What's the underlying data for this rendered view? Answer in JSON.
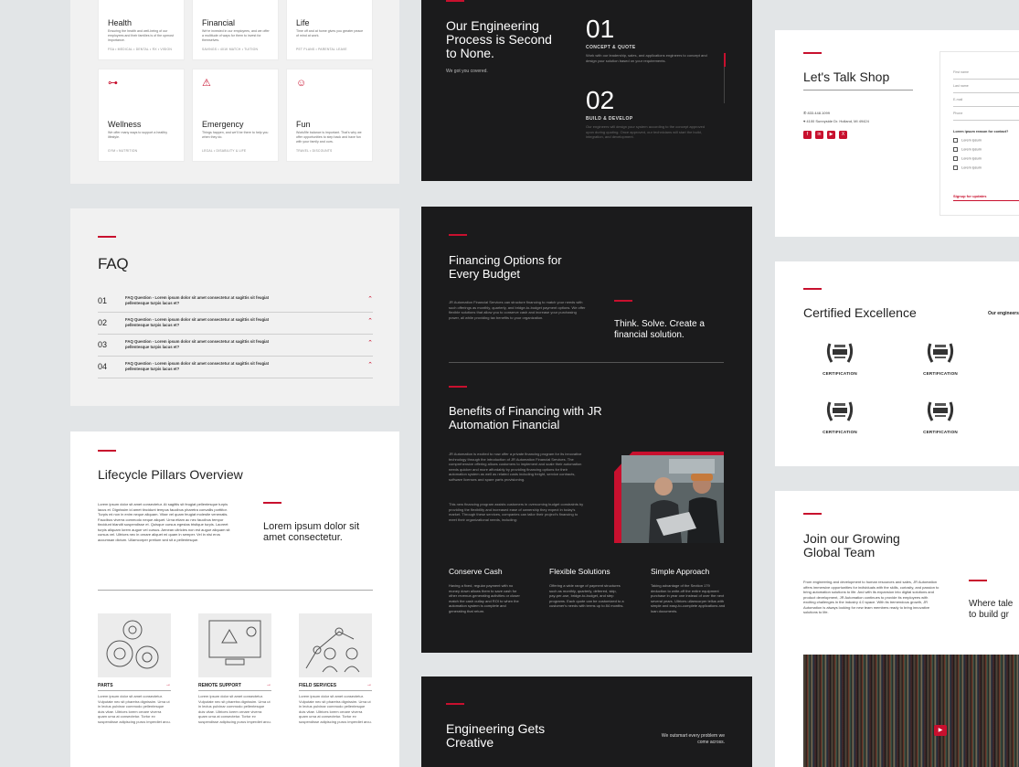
{
  "benefits": [
    {
      "title": "Health",
      "desc": "Ensuring the health and well-being of our employees and their families is of the upmost importance.",
      "footer": "FSA • MEDICAL • DENTAL • RX • VISION",
      "icon": "health-icon",
      "glyph": ""
    },
    {
      "title": "Financial",
      "desc": "We're invested in our employees, and we offer a multitude of ways for them to invest for themselves.",
      "footer": "SAVINGS • 401K MATCH • TUITION",
      "icon": "financial-icon",
      "glyph": ""
    },
    {
      "title": "Life",
      "desc": "Time off and at home gives you greater peace of mind at work.",
      "footer": "PET PLANS • PARENTAL LEAVE",
      "icon": "life-icon",
      "glyph": ""
    },
    {
      "title": "Wellness",
      "desc": "We offer many ways to support a healthy lifestyle.",
      "footer": "GYM • NUTRITION",
      "icon": "dumbbell-icon",
      "glyph": "⊶"
    },
    {
      "title": "Emergency",
      "desc": "Things happen, and we'll be there to help you when they do.",
      "footer": "LEGAL • DISABILITY & LIFE",
      "icon": "warning-icon",
      "glyph": "⚠"
    },
    {
      "title": "Fun",
      "desc": "Work/life balance is important. That's why we offer opportunities to step back and have fun with your family and ours.",
      "footer": "TRAVEL • DISCOUNTS",
      "icon": "smiley-icon",
      "glyph": "☺"
    }
  ],
  "engineering": {
    "title": "Our Engineering Process is Second to None.",
    "subtitle": "We got you covered.",
    "steps": [
      {
        "num": "01",
        "title": "CONCEPT & QUOTE",
        "desc": "Work with our leadership, sales, and applications engineers to concept and design your solution based on your requirements."
      },
      {
        "num": "02",
        "title": "BUILD & DEVELOP",
        "desc": "Our engineers will design your system according to the concept approved upon during quoting. Once approved, our technicians will start the build, integration, and development."
      }
    ]
  },
  "contact": {
    "title": "Let's Talk Shop",
    "phone": "833.448.1099",
    "address": "4100 Sunnyside Dr. Holland, MI 49424",
    "socials": [
      "f",
      "in",
      "▶",
      "X"
    ],
    "fields": [
      "First name",
      "Last name",
      "E-mail",
      "Phone"
    ],
    "reason_label": "Lorem ipsum reason for contact?",
    "options": [
      "Lorem ipsum",
      "Lorem ipsum",
      "Lorem ipsum",
      "Lorem ipsum"
    ],
    "signup": "Signup for updates"
  },
  "faq": {
    "title": "FAQ",
    "items": [
      {
        "num": "01",
        "q": "FAQ Question - Lorem ipsum dolor sit amet consectetur at sagittis sit feugiat pellentesque turpis lacus et?"
      },
      {
        "num": "02",
        "q": "FAQ Question - Lorem ipsum dolor sit amet consectetur at sagittis sit feugiat pellentesque turpis lacus et?"
      },
      {
        "num": "03",
        "q": "FAQ Question - Lorem ipsum dolor sit amet consectetur at sagittis sit feugiat pellentesque turpis lacus et?"
      },
      {
        "num": "04",
        "q": "FAQ Question - Lorem ipsum dolor sit amet consectetur at sagittis sit feugiat pellentesque turpis lacus et?"
      }
    ]
  },
  "financing": {
    "title": "Financing Options for Every Budget",
    "body": "JR Automation Financial Services can structure financing to match your needs with such offerings as monthly, quarterly, and bridge-to-budget payment options. We offer flexible solutions that allow you to conserve cash and increase your purchasing power, all while providing tax benefits to your organization.",
    "tagline": "Think. Solve. Create a financial solution.",
    "benefits_title": "Benefits of Financing with JR Automation Financial",
    "benefits_body_1": "JR Automation is excited to now offer a private financing program for its innovative technology through the introduction of JR Automation Financial Services. The comprehensive offering allows customers to implement and scale their automation needs quicker and more affordably by providing financing options for their automation system as well as related costs including freight, service contracts, software licenses and spare parts provisioning.",
    "benefits_body_2": "This new financing program assists customers in overcoming budget constraints by providing the flexibility and increased ease of ownership they expect in today's market. Through these services, companies can tailor their project's financing to meet their organizational needs, including:",
    "columns": [
      {
        "title": "Conserve Cash",
        "desc": "Having a fixed, regular payment with no money down allows them to save cash for other revenue-generating activities or closer match the cash outlay and ROI to when the automation system is complete and generating that return."
      },
      {
        "title": "Flexible Solutions",
        "desc": "Offering a wide range of payment structures such as monthly, quarterly, deferred, skip, pay-per-use, bridge-to-budget, and step programs. Each quote can be customized to a customer's needs with terms up to 84 months."
      },
      {
        "title": "Simple Approach",
        "desc": "Taking advantage of the Section 179 deduction to write-off the entire equipment purchase in year one instead of over the next several years. Ultrices ullamcorper tellus with simple and easy-to-complete applications and loan documents."
      }
    ]
  },
  "certified": {
    "title": "Certified Excellence",
    "side_text": "Our engineers",
    "badges": [
      "CERTIFICATION",
      "CERTIFICATION",
      "CERTIFICATION",
      "CERTIFICATION"
    ]
  },
  "lifecycle": {
    "title": "Lifecycle Pillars Overview",
    "body": "Lorem ipsum dolor sit amet consectetur. At sagittis sit feugiat pellentesque turpis lacus et. Dignissim id amet tincidunt tempus faucibus pharetra convallis porttitor. Turpis mi non in enim neque aliquam. Vitae vel quam feugiat molestie venenatis. Faucibus viverra commodo neque aliquet. Urna etiam ac nec faucibus tempor tincidunt blandit suspendisse et. Quisque cursus egestas tristique turpis. Laoreet turpis aliquam lorem augue vel cursus. Aenean ultricies non est augue aliquam sit cursus vel. Ultrices nec in ornare aliquet mi quam in semper. Vel in nisi eros accumsan dictum. Ullamcorper pretium sed sit a pellentesque.",
    "tagline": "Lorem ipsum dolor sit amet consectetur.",
    "pillars": [
      {
        "title": "PARTS",
        "desc": "Lorem ipsum dolor sit amet consectetur. Vulputate nec sit pharetra dignissim. Urna ut in lectus pulvinar commodo pellentesque duis vitae. Ultrices lorem ornare viverra quam urna at consectetur. Tortor ev suspendisse adipiscing purus imperdiet arcu."
      },
      {
        "title": "REMOTE SUPPORT",
        "desc": "Lorem ipsum dolor sit amet consectetur. Vulputate nec sit pharetra dignissim. Urna ut in lectus pulvinar commodo pellentesque duis vitae. Ultrices lorem ornare viverra quam urna at consectetur. Tortor ev suspendisse adipiscing purus imperdiet arcu."
      },
      {
        "title": "FIELD SERVICES",
        "desc": "Lorem ipsum dolor sit amet consectetur. Vulputate nec sit pharetra dignissim. Urna ut in lectus pulvinar commodo pellentesque duis vitae. Ultrices lorem ornare viverra quam urna at consectetur. Tortor ev suspendisse adipiscing purus imperdiet arcu."
      }
    ]
  },
  "careers": {
    "title": "Join our Growing Global Team",
    "body": "From engineering and development to human resources and sales, JR Automation offers immersive opportunities for individuals with the skills, curiosity, and passion to bring automation solutions to life. And with its expansion into digital solutions and product development, JR Automation continues to provide its employees with exciting challenges in the industry 4.0 space. With its tremendous growth, JR Automation is always looking for new team members ready to bring innovative solutions to life.",
    "tagline": "Where tale to build gr"
  },
  "creative": {
    "title": "Engineering Gets Creative",
    "side": "We outsmart every problem we come across."
  },
  "colors": {
    "accent": "#c8102e",
    "dark": "#1b1b1c",
    "page": "#e2e5e7"
  }
}
